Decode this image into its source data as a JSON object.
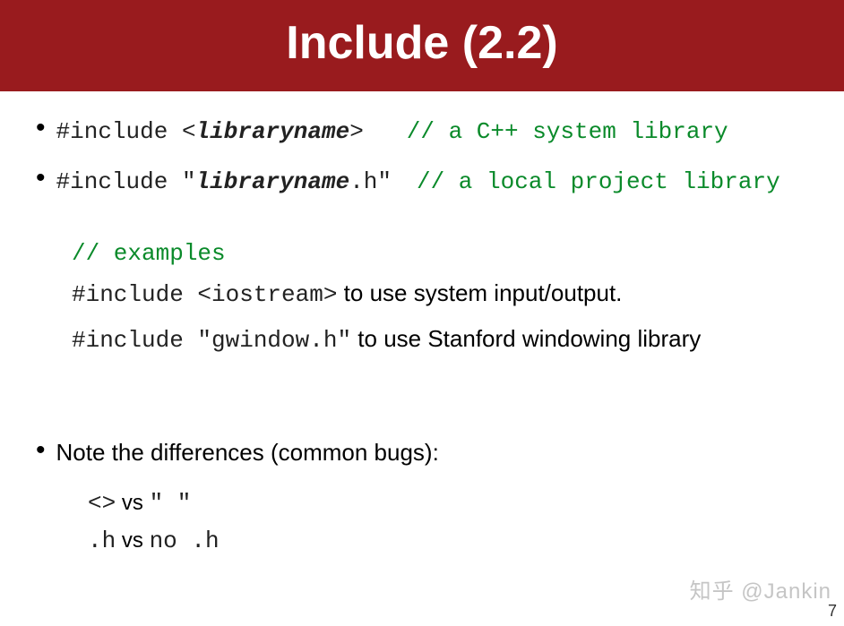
{
  "header": {
    "title": "Include (2.2)"
  },
  "bullet1": {
    "prefix": "#include <",
    "libname": "libraryname",
    "suffix": ">",
    "comment": "// a C++ system library"
  },
  "bullet2": {
    "prefix": "#include \"",
    "libname": "libraryname",
    "suffix": ".h\"",
    "comment": "// a local project library"
  },
  "examples": {
    "heading": "// examples",
    "line1_code": "#include <iostream>",
    "line1_text": " to use system input/output.",
    "line2_code": "#include \"gwindow.h\"",
    "line2_text": " to use Stanford windowing library"
  },
  "note": {
    "heading": "Note the differences (common bugs):",
    "line1_a": "<>",
    "line1_vs": " vs ",
    "line1_b": "\" \"",
    "line2_a": ".h",
    "line2_vs": " vs ",
    "line2_b": "no .h"
  },
  "footer": {
    "page": "7",
    "watermark": "知乎 @Jankin"
  }
}
